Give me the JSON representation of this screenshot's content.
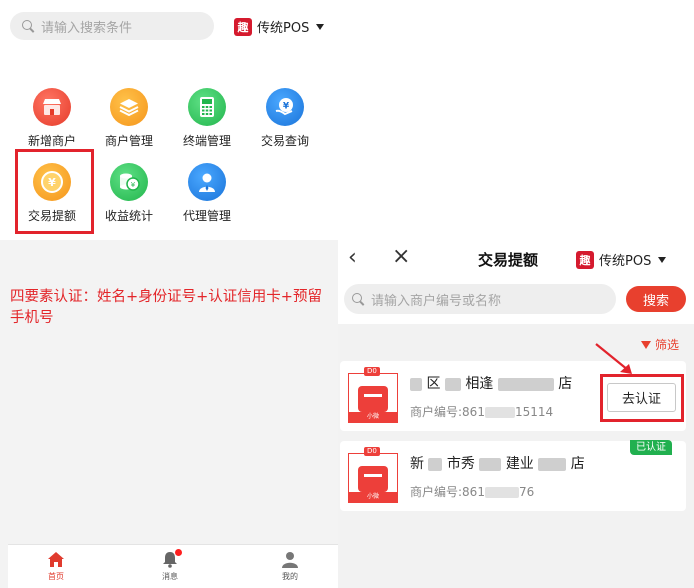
{
  "left": {
    "search_placeholder": "请输入搜索条件",
    "brand": {
      "logo_text": "趣",
      "name": "传统POS"
    },
    "grid": [
      {
        "label": "新增商户",
        "icon": "store-icon"
      },
      {
        "label": "商户管理",
        "icon": "layers-icon"
      },
      {
        "label": "终端管理",
        "icon": "pos-terminal-icon"
      },
      {
        "label": "交易查询",
        "icon": "yuan-query-icon"
      },
      {
        "label": "交易提额",
        "icon": "yuan-coin-icon"
      },
      {
        "label": "收益统计",
        "icon": "coins-icon"
      },
      {
        "label": "代理管理",
        "icon": "agent-person-icon"
      }
    ],
    "note": "四要素认证：姓名+身份证号+认证信用卡+预留手机号",
    "tabs": [
      {
        "label": "首页",
        "icon": "home-icon"
      },
      {
        "label": "消息",
        "icon": "bell-icon"
      },
      {
        "label": "我的",
        "icon": "user-icon"
      }
    ]
  },
  "right": {
    "title": "交易提额",
    "brand": {
      "logo_text": "趣",
      "name": "传统POS"
    },
    "search_placeholder": "请输入商户编号或名称",
    "search_button": "搜索",
    "filter_label": "筛选",
    "merchants": [
      {
        "badge": "D0",
        "tag": "小微",
        "name_parts": [
          "区",
          "相逢",
          "店"
        ],
        "id_label": "商户编号:",
        "id_prefix": "861",
        "id_suffix": "15114",
        "action": "去认证"
      },
      {
        "badge": "D0",
        "tag": "小微",
        "name_parts": [
          "新",
          "市秀",
          "建业",
          "店"
        ],
        "id_label": "商户编号:",
        "id_prefix": "861",
        "id_suffix": "76",
        "status": "已认证"
      }
    ]
  },
  "colors": {
    "accent_red": "#e8402e",
    "highlight_red": "#e2232c",
    "verified_green": "#21b04f"
  }
}
